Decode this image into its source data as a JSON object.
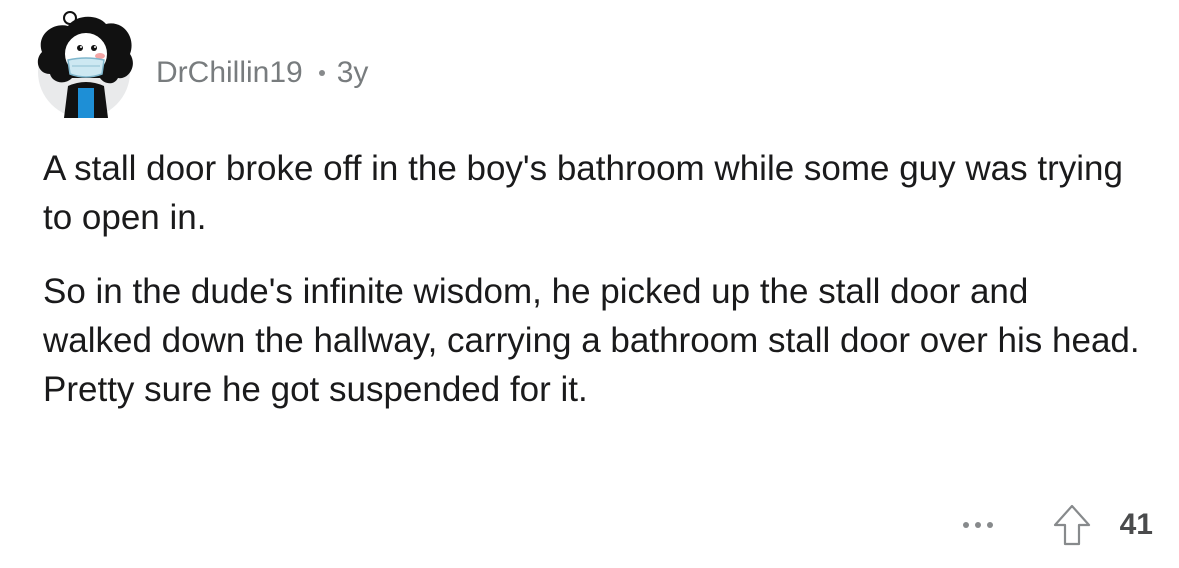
{
  "comment": {
    "author": "DrChillin19",
    "separator": "•",
    "age": "3y",
    "paragraphs": [
      "A stall door broke off in the boy's bathroom while some guy was trying to open in.",
      "So in the dude's infinite wisdom, he picked up the stall door and walked down the hallway, carrying a bathroom stall door over his head. Pretty sure he got suspended for it."
    ],
    "score": "41"
  },
  "icons": {
    "avatar": "snoo-avatar-icon",
    "more": "more-options-icon",
    "upvote": "upvote-arrow-icon"
  },
  "colors": {
    "text": "#1a1a1b",
    "meta": "#787c7e",
    "icon": "#878a8c",
    "avatar_bg": "#e9eaeb",
    "avatar_hair": "#111111",
    "avatar_shirt": "#1e8fd6"
  }
}
